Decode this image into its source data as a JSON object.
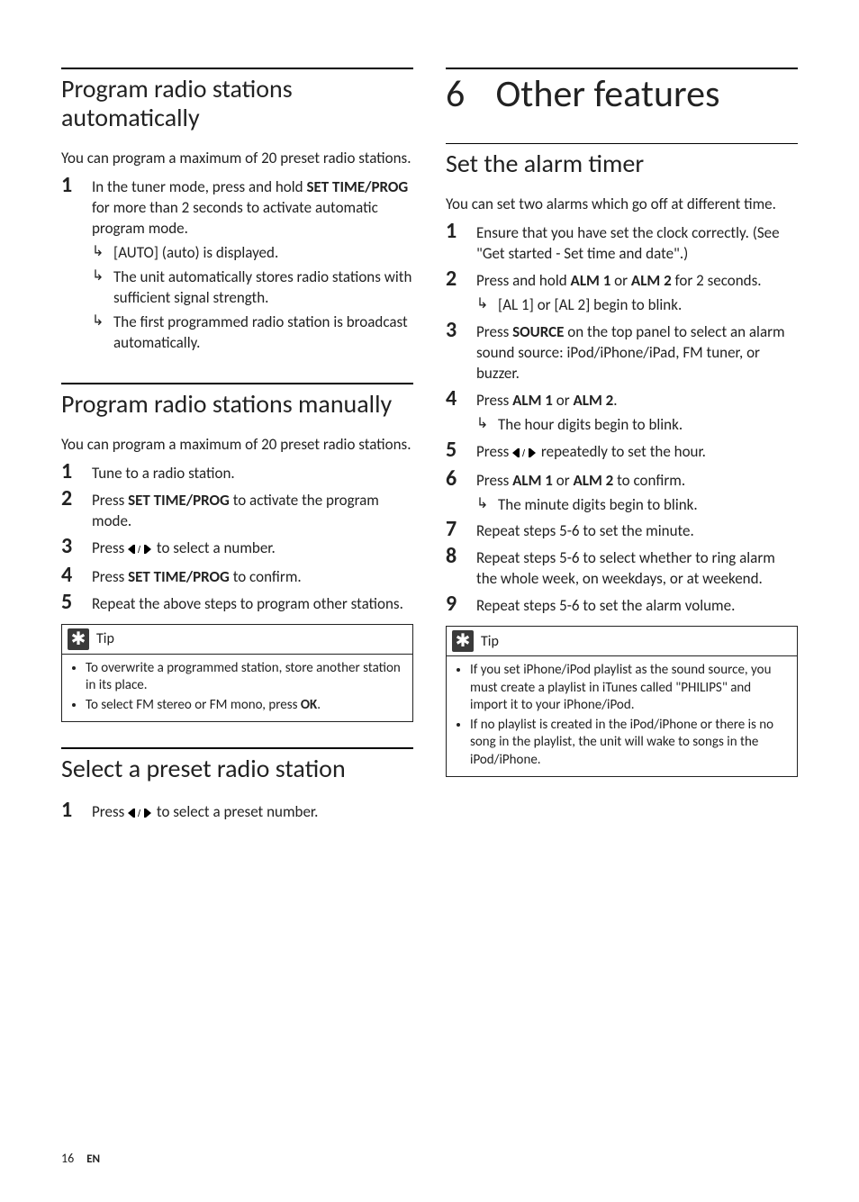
{
  "left": {
    "sec1": {
      "heading": "Program radio stations automatically",
      "intro": "You can program a maximum of 20 preset radio stations.",
      "step1_a": "In the tuner mode, press and hold ",
      "step1_btn": "SET TIME/PROG",
      "step1_b": " for more than 2 seconds to activate automatic program mode.",
      "sub1": "[AUTO] (auto) is displayed.",
      "sub2": "The unit automatically stores radio stations with sufficient signal strength.",
      "sub3": "The first programmed radio station is broadcast automatically."
    },
    "sec2": {
      "heading": "Program radio stations manually",
      "intro": "You can program a maximum of 20 preset radio stations.",
      "step1": "Tune to a radio station.",
      "step2_a": "Press ",
      "step2_btn": "SET TIME/PROG",
      "step2_b": " to activate the program mode.",
      "step3_a": "Press ",
      "step3_b": " to select a number.",
      "step4_a": "Press ",
      "step4_btn": "SET TIME/PROG",
      "step4_b": " to confirm.",
      "step5": "Repeat the above steps to program other stations.",
      "tip_label": "Tip",
      "tip1": "To overwrite a programmed station, store another station in its place.",
      "tip2_a": "To select FM stereo or FM mono, press ",
      "tip2_btn": "OK",
      "tip2_b": "."
    },
    "sec3": {
      "heading": "Select a preset radio station",
      "step1_a": "Press ",
      "step1_b": " to select a preset number."
    }
  },
  "right": {
    "chapter_num": "6",
    "chapter_title": "Other features",
    "sec1": {
      "heading": "Set the alarm timer",
      "intro": "You can set two alarms which go off at different time.",
      "step1": "Ensure that you have set the clock correctly. (See \"Get started - Set time and date\".)",
      "step2_a": "Press and hold ",
      "step2_btn1": "ALM 1",
      "step2_mid": " or ",
      "step2_btn2": "ALM 2",
      "step2_b": " for 2 seconds.",
      "step2_sub": "[AL 1] or [AL 2] begin to blink.",
      "step3_a": "Press ",
      "step3_btn": "SOURCE",
      "step3_b": " on the top panel to select an alarm sound source: iPod/iPhone/iPad, FM tuner, or buzzer.",
      "step4_a": "Press ",
      "step4_btn1": "ALM 1",
      "step4_mid": " or ",
      "step4_btn2": "ALM 2",
      "step4_b": ".",
      "step4_sub": "The hour digits begin to blink.",
      "step5_a": "Press ",
      "step5_b": " repeatedly to set the hour.",
      "step6_a": "Press ",
      "step6_btn1": "ALM 1",
      "step6_mid": " or ",
      "step6_btn2": "ALM 2",
      "step6_b": " to confirm.",
      "step6_sub": "The minute digits begin to blink.",
      "step7": "Repeat steps 5-6 to set the minute.",
      "step8": "Repeat steps 5-6 to select whether to ring alarm the whole week, on weekdays, or at weekend.",
      "step9": "Repeat steps 5-6 to set the alarm volume.",
      "tip_label": "Tip",
      "tip1": "If you set iPhone/iPod playlist as the sound source, you must create a playlist in iTunes called \"PHILIPS\" and import it to your iPhone/iPod.",
      "tip2": "If no playlist is created in the iPod/iPhone or there is no song in the playlist, the unit will wake to songs in the iPod/iPhone."
    }
  },
  "footer": {
    "page": "16",
    "lang": "EN"
  }
}
